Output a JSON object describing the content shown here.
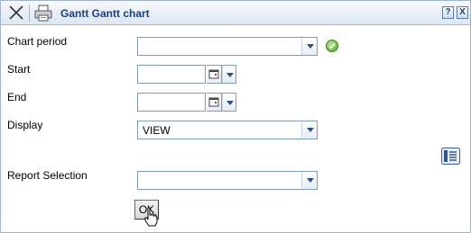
{
  "window": {
    "title": "Gantt Gantt chart",
    "help_label": "?",
    "close_label": "X",
    "toolbar_icons": [
      "close-icon",
      "print-icon"
    ]
  },
  "form": {
    "chart_period": {
      "label": "Chart period",
      "value": ""
    },
    "start": {
      "label": "Start",
      "value": ""
    },
    "end": {
      "label": "End",
      "value": ""
    },
    "display": {
      "label": "Display",
      "value": "VIEW"
    },
    "report_selection": {
      "label": "Report Selection",
      "value": ""
    },
    "ok_label": "OK"
  },
  "colors": {
    "title_text": "#1a3f8c",
    "titlebar_top": "#f7f9fc",
    "titlebar_bottom": "#dde6f2",
    "field_border": "#7f9db9",
    "confirm_green": "#4ca32a"
  }
}
